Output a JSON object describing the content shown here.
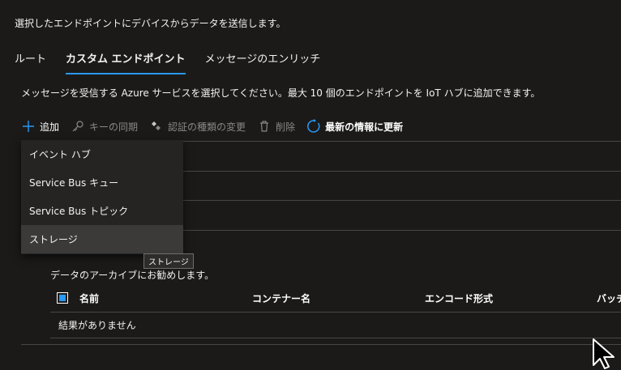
{
  "intro_text": "選択したエンドポイントにデバイスからデータを送信します。",
  "tabs": [
    {
      "label": "ルート"
    },
    {
      "label": "カスタム エンドポイント"
    },
    {
      "label": "メッセージのエンリッチ"
    }
  ],
  "description": "メッセージを受信する Azure サービスを選択してください。最大 10 個のエンドポイントを IoT ハブに追加できます。",
  "toolbar": {
    "add": "追加",
    "sync_keys": "キーの同期",
    "change_auth": "認証の種類の変更",
    "delete": "削除",
    "refresh": "最新の情報に更新"
  },
  "dropdown": {
    "items": [
      {
        "label": "イベント ハブ"
      },
      {
        "label": "Service Bus キュー"
      },
      {
        "label": "Service Bus トピック"
      },
      {
        "label": "ストレージ"
      }
    ]
  },
  "tooltip": "ストレージ",
  "archive_text": "データのアーカイブにお勧めします。",
  "table": {
    "columns": [
      "名前",
      "コンテナー名",
      "エンコード形式",
      "バッチ"
    ],
    "empty_text": "結果がありません"
  },
  "colors": {
    "accent": "#2899f5",
    "background": "#1b1a19"
  }
}
